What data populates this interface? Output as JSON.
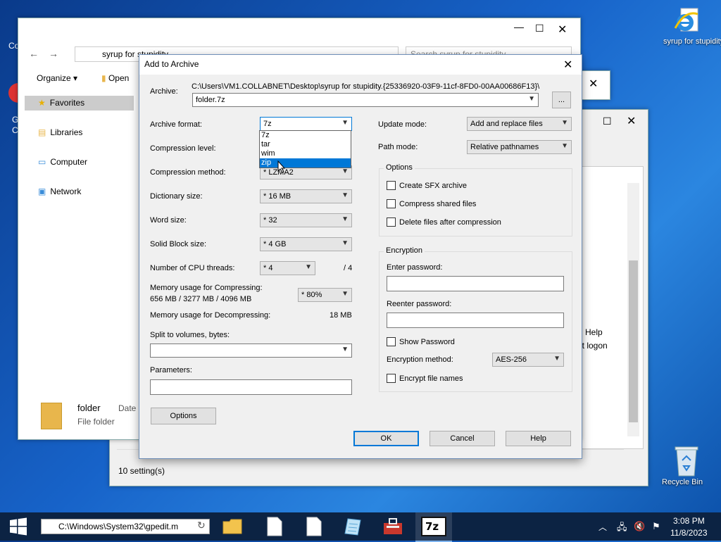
{
  "desktop": {
    "icons": [
      {
        "label": "syrup for stupidity"
      },
      {
        "label": "Recycle Bin"
      }
    ],
    "partial_left": "Co",
    "partial_left2": "G",
    "partial_left3": "C"
  },
  "explorer": {
    "address": "syrup for stupidity",
    "search_placeholder": "Search syrup for stupidity",
    "organize": "Organize",
    "open": "Open",
    "nav": [
      "Favorites",
      "Libraries",
      "Computer",
      "Network"
    ],
    "file_name": "folder",
    "file_type": "File folder",
    "file_date_col": "Date"
  },
  "gpedit_window": {
    "status": "10 setting(s)",
    "help": "Help",
    "logon": "it logon"
  },
  "dialog": {
    "title": "Add to Archive",
    "archive_label": "Archive:",
    "archive_path": "C:\\Users\\VM1.COLLABNET\\Desktop\\syrup for stupidity.{25336920-03F9-11cf-8FD0-00AA00686F13}\\",
    "archive_name": "folder.7z",
    "browse": "...",
    "left": {
      "archive_format_label": "Archive format:",
      "archive_format": "7z",
      "format_options": [
        "7z",
        "tar",
        "wim",
        "zip"
      ],
      "compression_level_label": "Compression level:",
      "compression_method_label": "Compression method:",
      "compression_method": "* LZMA2",
      "dictionary_size_label": "Dictionary size:",
      "dictionary_size": "* 16 MB",
      "word_size_label": "Word size:",
      "word_size": "* 32",
      "solid_block_label": "Solid Block size:",
      "solid_block": "* 4 GB",
      "cpu_threads_label": "Number of CPU threads:",
      "cpu_threads": "* 4",
      "cpu_threads_max": "/ 4",
      "mem_compress_label": "Memory usage for Compressing:",
      "mem_compress_value": "656 MB / 3277 MB / 4096 MB",
      "mem_compress_pct": "* 80%",
      "mem_decompress_label": "Memory usage for Decompressing:",
      "mem_decompress_value": "18 MB",
      "split_label": "Split to volumes, bytes:",
      "split_value": "",
      "parameters_label": "Parameters:",
      "parameters_value": "",
      "options_button": "Options"
    },
    "right": {
      "update_mode_label": "Update mode:",
      "update_mode": "Add and replace files",
      "path_mode_label": "Path mode:",
      "path_mode": "Relative pathnames",
      "options_group": "Options",
      "create_sfx": "Create SFX archive",
      "compress_shared": "Compress shared files",
      "delete_after": "Delete files after compression",
      "encryption_group": "Encryption",
      "enter_password_label": "Enter password:",
      "reenter_password_label": "Reenter password:",
      "show_password": "Show Password",
      "encryption_method_label": "Encryption method:",
      "encryption_method": "AES-256",
      "encrypt_names": "Encrypt file names"
    },
    "buttons": {
      "ok": "OK",
      "cancel": "Cancel",
      "help": "Help"
    }
  },
  "taskbar": {
    "run_path": "C:\\Windows\\System32\\gpedit.m",
    "time": "3:08 PM",
    "date": "11/8/2023",
    "active_app": "7z"
  }
}
